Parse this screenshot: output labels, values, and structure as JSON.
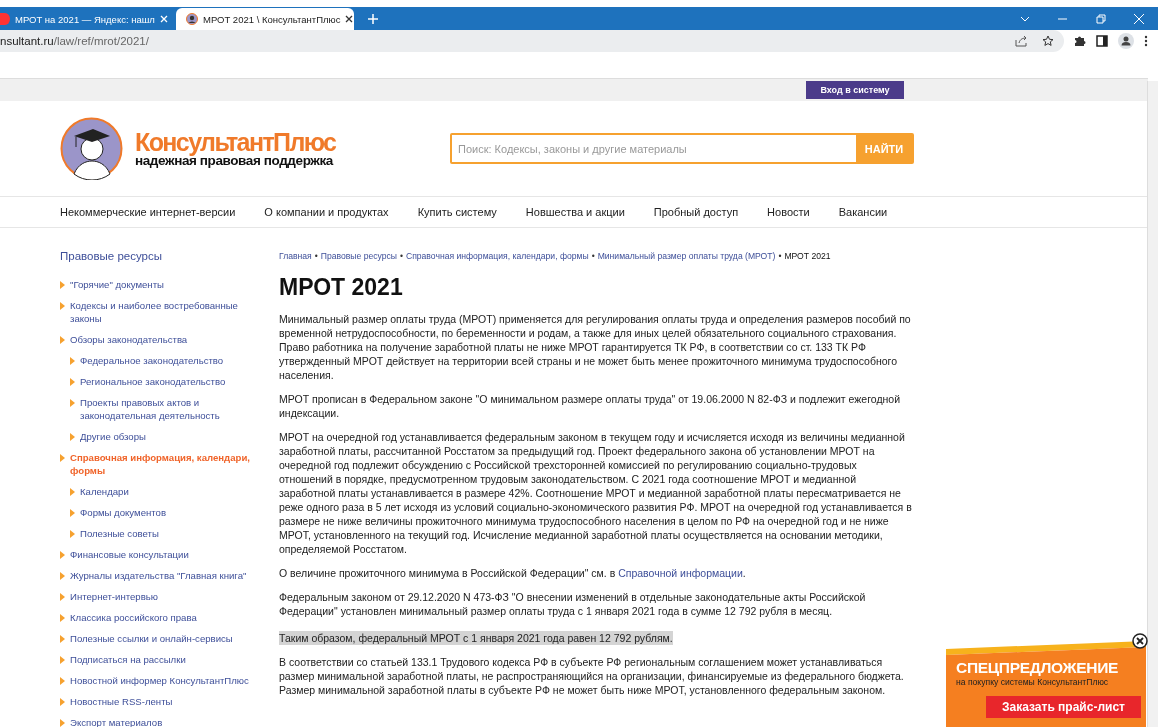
{
  "browser": {
    "tabs": [
      {
        "title": "МРОТ на 2021 — Яндекс: нашл",
        "kind": "dot",
        "selected": false
      },
      {
        "title": "МРОТ 2021 \\ КонсультантПлюс",
        "kind": "portrait",
        "selected": true
      }
    ],
    "address": {
      "host": "nsultant.ru",
      "path": "/law/ref/mrot/2021/"
    }
  },
  "site": {
    "login_button": "Вход в систему",
    "logo": {
      "name": "КонсультантПлюс",
      "tagline": "надежная правовая поддержка"
    },
    "search": {
      "placeholder": "Поиск: Кодексы, законы и другие материалы",
      "button": "НАЙТИ"
    },
    "nav": [
      "Некоммерческие интернет-версии",
      "О компании и продуктах",
      "Купить систему",
      "Новшества и акции",
      "Пробный доступ",
      "Новости",
      "Вакансии"
    ]
  },
  "sidebar": {
    "title": "Правовые ресурсы",
    "items": [
      {
        "label": "\"Горячие\" документы",
        "selected": false
      },
      {
        "label": "Кодексы и наиболее востребованные законы",
        "selected": false
      },
      {
        "label": "Обзоры законодательства",
        "selected": false,
        "children": [
          {
            "label": "Федеральное законодательство",
            "selected": false
          },
          {
            "label": "Региональное законодательство",
            "selected": false
          },
          {
            "label": "Проекты правовых актов и законодательная деятельность",
            "selected": false
          },
          {
            "label": "Другие обзоры",
            "selected": false
          }
        ]
      },
      {
        "label": "Справочная информация, календари, формы",
        "selected": true,
        "children": [
          {
            "label": "Календари",
            "selected": false
          },
          {
            "label": "Формы документов",
            "selected": false
          },
          {
            "label": "Полезные советы",
            "selected": false
          }
        ]
      },
      {
        "label": "Финансовые консультации",
        "selected": false
      },
      {
        "label": "Журналы издательства \"Главная книга\"",
        "selected": false
      },
      {
        "label": "Интернет-интервью",
        "selected": false
      },
      {
        "label": "Классика российского права",
        "selected": false
      },
      {
        "label": "Полезные ссылки и онлайн-сервисы",
        "selected": false
      },
      {
        "label": "Подписаться на рассылки",
        "selected": false
      },
      {
        "label": "Новостной информер КонсультантПлюс",
        "selected": false
      },
      {
        "label": "Новостные RSS-ленты",
        "selected": false
      },
      {
        "label": "Экспорт материалов",
        "selected": false
      }
    ]
  },
  "article": {
    "breadcrumb": {
      "separator": "•",
      "items": [
        {
          "label": "Главная",
          "current": false
        },
        {
          "label": "Правовые ресурсы",
          "current": false
        },
        {
          "label": "Справочная информация, календари, формы",
          "current": false
        },
        {
          "label": "Минимальный размер оплаты труда (МРОТ)",
          "current": false
        },
        {
          "label": "МРОТ 2021",
          "current": true
        }
      ]
    },
    "title": "МРОТ 2021",
    "paragraphs": [
      {
        "text": "Минимальный размер оплаты труда (МРОТ) применяется для регулирования оплаты труда и определения размеров пособий по временной нетрудоспособности, по беременности и родам, а также для иных целей обязательного социального страхования. Право работника на получение заработной платы не ниже МРОТ гарантируется ТК РФ, в соответствии со ст. 133 ТК РФ утвержденный МРОТ действует на территории всей страны и не может быть менее прожиточного минимума трудоспособного населения.",
        "highlighted": false
      },
      {
        "text": "МРОТ прописан в Федеральном законе \"О минимальном размере оплаты труда\" от 19.06.2000 N 82-ФЗ и подлежит ежегодной индексации.",
        "highlighted": false
      },
      {
        "text": "МРОТ на очередной год устанавливается федеральным законом в текущем году и исчисляется исходя из величины медианной заработной платы, рассчитанной Росстатом за предыдущий год. Проект федерального закона об установлении МРОТ на очередной год подлежит обсуждению с Российской трехсторонней комиссией по регулированию социально-трудовых отношений в порядке, предусмотренном трудовым законодательством. С 2021 года соотношение МРОТ и медианной заработной платы устанавливается в размере 42%. Соотношение МРОТ и медианной заработной платы пересматривается не реже одного раза в 5 лет исходя из условий социально-экономического развития РФ. МРОТ на очередной год устанавливается в размере не ниже величины прожиточного минимума трудоспособного населения в целом по РФ на очередной год и не ниже МРОТ, установленного на текущий год. Исчисление медианной заработной платы осуществляется на основании методики, определяемой Росстатом.",
        "highlighted": false
      },
      {
        "text": "О величине прожиточного минимума в Российской Федерации\" см. в ",
        "link": "Справочной информации",
        "after": ".",
        "highlighted": false
      },
      {
        "text": "Федеральным законом от 29.12.2020 N 473-ФЗ \"О внесении изменений в отдельные законодательные акты Российской Федерации\" установлен минимальный размер оплаты труда с 1 января 2021 года в сумме 12 792 рубля в месяц.",
        "highlighted": false
      },
      {
        "text": "Таким образом, федеральный МРОТ с 1 января 2021 года равен 12 792 рублям.",
        "highlighted": true
      },
      {
        "text": "В соответствии со статьей 133.1 Трудового кодекса РФ в субъекте РФ региональным соглашением может устанавливаться размер минимальной заработной платы, не распространяющийся на организации, финансируемые из федерального бюджета. Размер минимальной заработной платы в субъекте РФ не может быть ниже МРОТ, установленного федеральным законом.",
        "highlighted": false
      }
    ]
  },
  "promo": {
    "title": "СПЕЦПРЕДЛОЖЕНИЕ",
    "subtitle": "на покупку системы КонсультантПлюс",
    "button": "Заказать прайс-лист"
  }
}
